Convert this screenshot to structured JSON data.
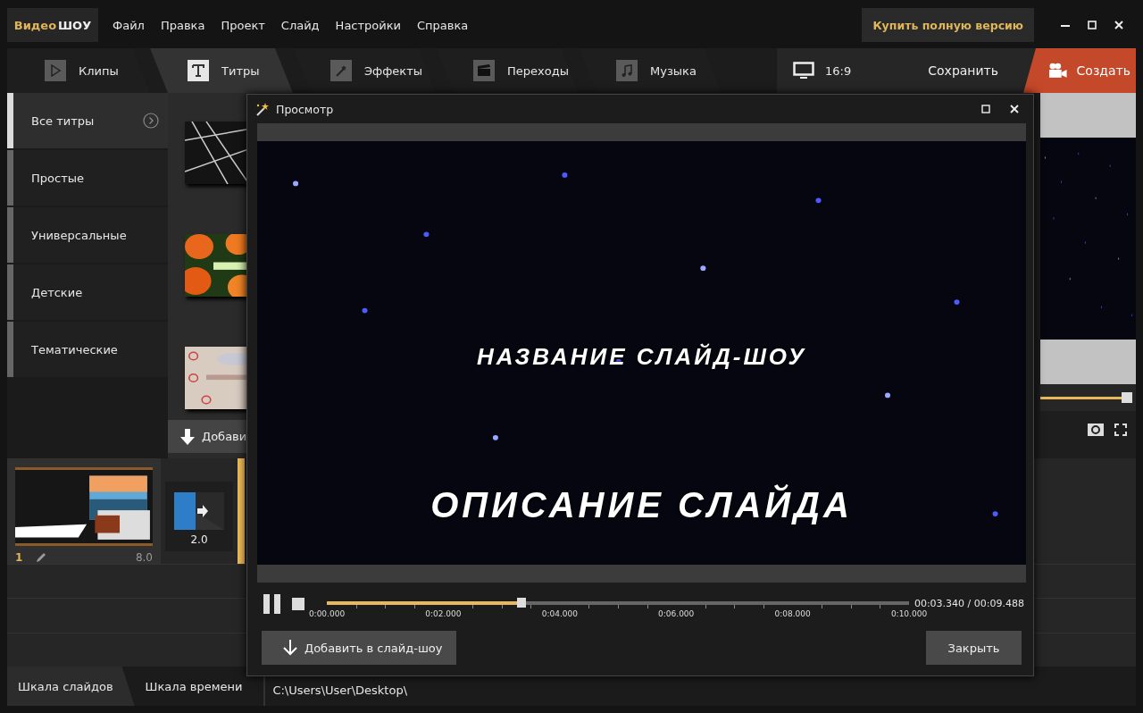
{
  "app": {
    "logo": {
      "part_1": "Видео",
      "part_2": "ШОУ"
    },
    "menu": [
      "Файл",
      "Правка",
      "Проект",
      "Слайд",
      "Настройки",
      "Справка"
    ],
    "buy_button": "Купить полную версию"
  },
  "tabs": [
    {
      "label": "Клипы",
      "kind": "clips",
      "selected": false
    },
    {
      "label": "Титры",
      "kind": "titles",
      "selected": true
    },
    {
      "label": "Эффекты",
      "kind": "effects",
      "selected": false
    },
    {
      "label": "Переходы",
      "kind": "transitions",
      "selected": false
    },
    {
      "label": "Музыка",
      "kind": "music",
      "selected": false
    }
  ],
  "aspect_ratio": "16:9",
  "save_button": "Сохранить",
  "create_button": "Создать",
  "categories": [
    {
      "label": "Все титры",
      "selected": true
    },
    {
      "label": "Простые",
      "selected": false
    },
    {
      "label": "Универсальные",
      "selected": false
    },
    {
      "label": "Детские",
      "selected": false
    },
    {
      "label": "Тематические",
      "selected": false
    }
  ],
  "add_button": "Добави",
  "side_preview": {
    "level": 0.98
  },
  "slide": {
    "number": "1",
    "duration": "8.0"
  },
  "transition": {
    "duration": "2.0"
  },
  "bottom_tabs": [
    {
      "label": "Шкала слайдов",
      "selected": true
    },
    {
      "label": "Шкала времени",
      "selected": false
    }
  ],
  "path": "C:\\Users\\User\\Desktop\\",
  "dialog": {
    "title": "Просмотр",
    "preview_lines": [
      "НАЗВАНИЕ СЛАЙД-ШОУ",
      "ОПИСАНИЕ СЛАЙДА"
    ],
    "playing": true,
    "progress": {
      "level": 0.334,
      "ticks": [
        "0:00.000",
        "0:02.000",
        "0:04.000",
        "0:06.000",
        "0:08.000",
        "0:10.000"
      ]
    },
    "time": "00:03.340 / 00:09.488",
    "add_button": "Добавить в слайд-шоу",
    "close_button": "Закрыть"
  }
}
